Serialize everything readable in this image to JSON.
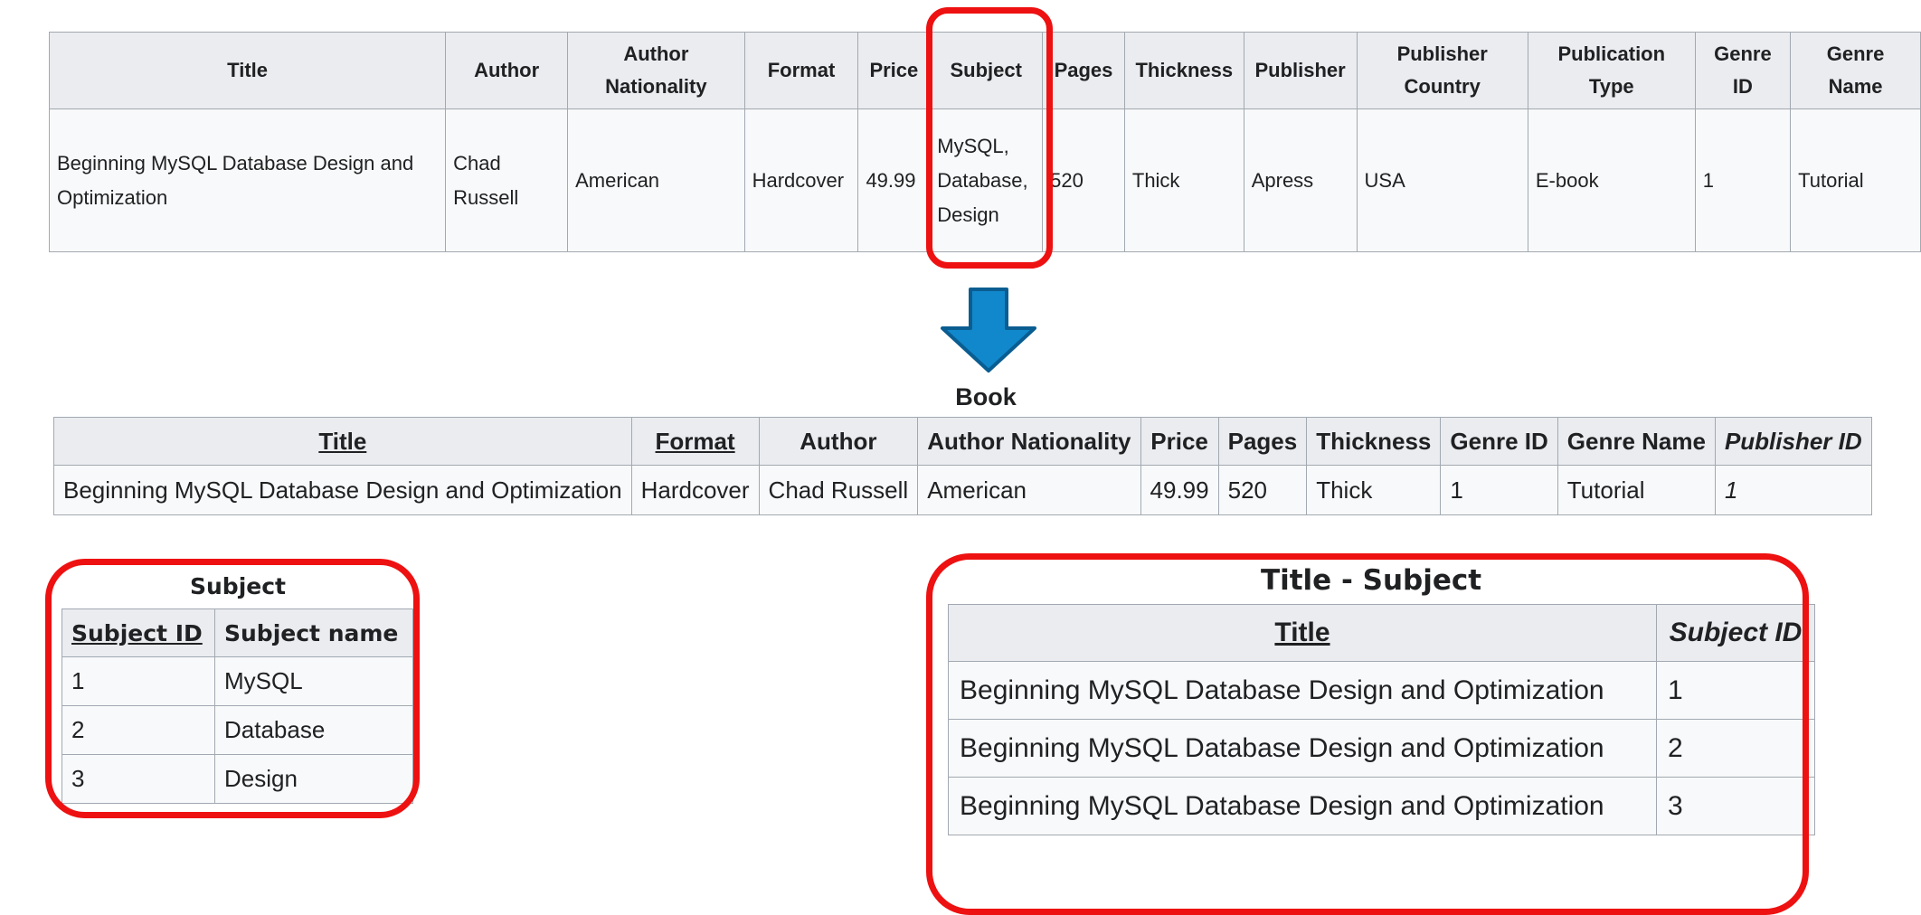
{
  "original_table": {
    "headers": [
      "Title",
      "Author",
      "Author Nationality",
      "Format",
      "Price",
      "Subject",
      "Pages",
      "Thickness",
      "Publisher",
      "Publisher Country",
      "Publication Type",
      "Genre ID",
      "Genre Name"
    ],
    "row": [
      "Beginning MySQL Database Design and Optimization",
      "Chad Russell",
      "American",
      "Hardcover",
      "49.99",
      "MySQL, Database, Design",
      "520",
      "Thick",
      "Apress",
      "USA",
      "E-book",
      "1",
      "Tutorial"
    ]
  },
  "book_table": {
    "caption": "Book",
    "headers": [
      "Title",
      "Format",
      "Author",
      "Author Nationality",
      "Price",
      "Pages",
      "Thickness",
      "Genre ID",
      "Genre Name",
      "Publisher ID"
    ],
    "row": [
      "Beginning MySQL Database Design and Optimization",
      "Hardcover",
      "Chad Russell",
      "American",
      "49.99",
      "520",
      "Thick",
      "1",
      "Tutorial",
      "1"
    ]
  },
  "subject_table": {
    "caption": "Subject",
    "headers": [
      "Subject ID",
      "Subject name"
    ],
    "rows": [
      [
        "1",
        "MySQL"
      ],
      [
        "2",
        "Database"
      ],
      [
        "3",
        "Design"
      ]
    ]
  },
  "title_subject_table": {
    "caption": "Title - Subject",
    "headers": [
      "Title",
      "Subject ID"
    ],
    "rows": [
      [
        "Beginning MySQL Database Design and Optimization",
        "1"
      ],
      [
        "Beginning MySQL Database Design and Optimization",
        "2"
      ],
      [
        "Beginning MySQL Database Design and Optimization",
        "3"
      ]
    ]
  },
  "colors": {
    "highlight": "#ee1111",
    "arrow_fill": "#1188cc",
    "arrow_stroke": "#0a5d91",
    "header_bg": "#eaecf0",
    "cell_bg": "#f8f9fa",
    "border": "#a2a9b1"
  }
}
